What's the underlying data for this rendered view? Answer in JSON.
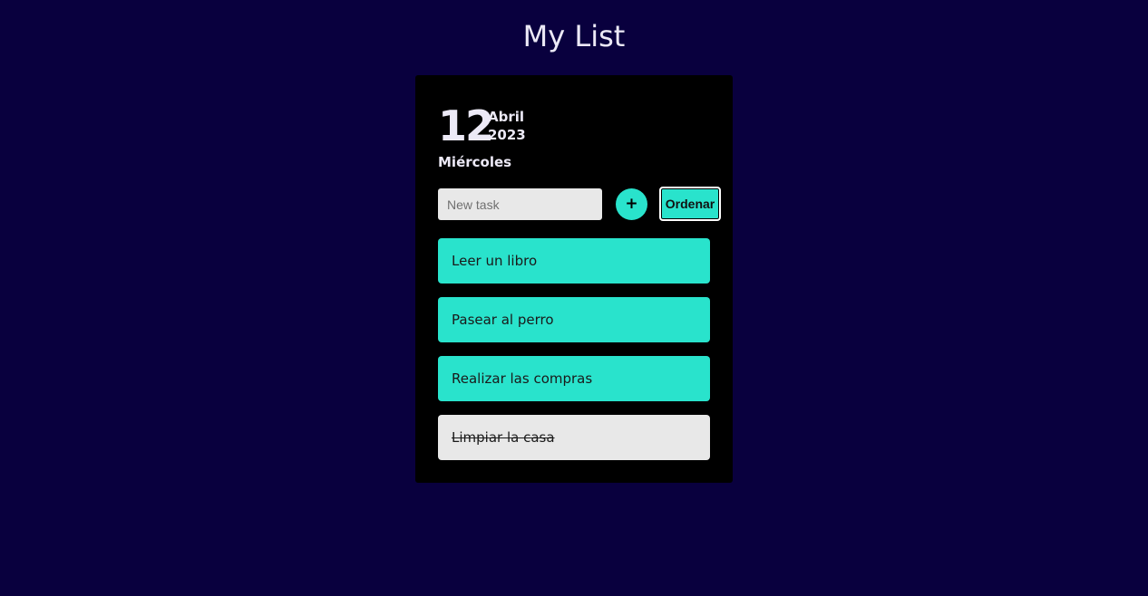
{
  "header": {
    "title": "My List"
  },
  "date": {
    "day": "12",
    "month": "Abril",
    "year": "2023",
    "weekday": "Miércoles"
  },
  "form": {
    "input_value": "",
    "input_placeholder": "New task",
    "add_label": "+",
    "sort_label": "Ordenar"
  },
  "tasks": [
    {
      "label": "Leer un libro",
      "done": false
    },
    {
      "label": "Pasear al perro",
      "done": false
    },
    {
      "label": "Realizar las compras",
      "done": false
    },
    {
      "label": "Limpiar la casa",
      "done": true
    }
  ],
  "colors": {
    "background": "#09003e",
    "card": "#000000",
    "accent": "#29e3cc",
    "done": "#e8e8e8"
  }
}
